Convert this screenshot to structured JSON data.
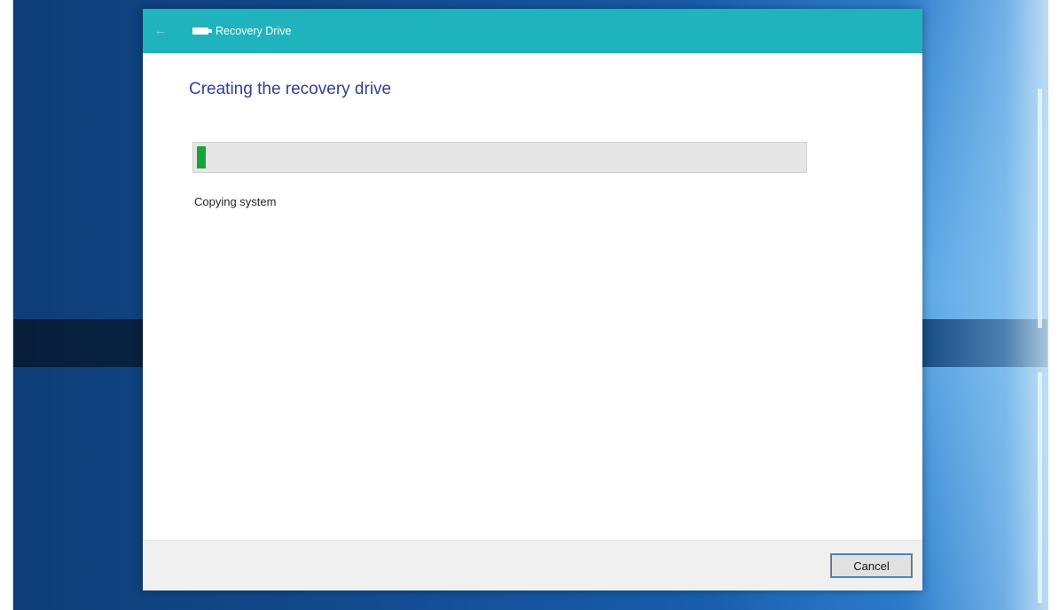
{
  "window": {
    "title": "Recovery Drive",
    "back_icon": "back-arrow-icon",
    "app_icon": "drive-icon",
    "accent_color": "#1fb3bd"
  },
  "main": {
    "heading": "Creating the recovery drive",
    "heading_color": "#2f3f99",
    "progress": {
      "percent": 1.5,
      "fill_color": "#16a33a"
    },
    "status": "Copying system"
  },
  "footer": {
    "cancel_label": "Cancel"
  }
}
